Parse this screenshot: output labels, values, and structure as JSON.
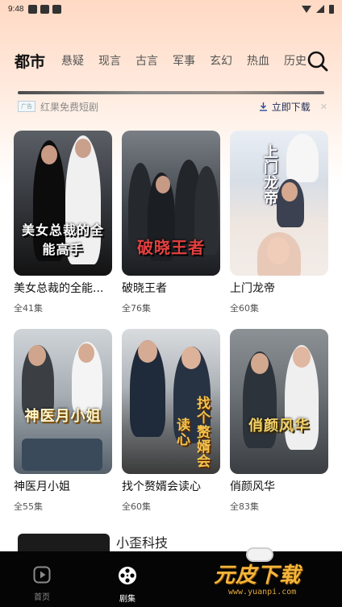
{
  "status_bar": {
    "time": "9:48"
  },
  "categories": {
    "active": "都市",
    "items": [
      "悬疑",
      "现言",
      "古言",
      "军事",
      "玄幻",
      "热血",
      "历史"
    ]
  },
  "ad_banner": {
    "tag": "广告",
    "text": "红果免费短剧",
    "download_label": "立即下载",
    "close_label": "✕"
  },
  "dramas": [
    {
      "name": "美女总裁的全能...",
      "episodes": "全41集",
      "cover_text": "美女总裁的全能高手"
    },
    {
      "name": "破晓王者",
      "episodes": "全76集",
      "cover_text": "破晓王者"
    },
    {
      "name": "上门龙帝",
      "episodes": "全60集",
      "cover_text": "上门龙帝"
    },
    {
      "name": "神医月小姐",
      "episodes": "全55集",
      "cover_text": "神医月小姐"
    },
    {
      "name": "找个赘婿会读心",
      "episodes": "全60集",
      "cover_text": "找个赘婿会读心"
    },
    {
      "name": "俏颜风华",
      "episodes": "全83集",
      "cover_text": "俏颜风华"
    }
  ],
  "bottom_ad": {
    "name": "小歪科技"
  },
  "bottom_nav": {
    "home_label": "首页",
    "drama_label": "剧集"
  },
  "watermark": {
    "main": "元皮下载",
    "url": "www.yuanpi.com"
  },
  "colors": {
    "header_gradient_top": "#ffd9c4",
    "nav_background": "#050505",
    "download_text": "#1a2a55",
    "watermark": "#f4b53a"
  }
}
